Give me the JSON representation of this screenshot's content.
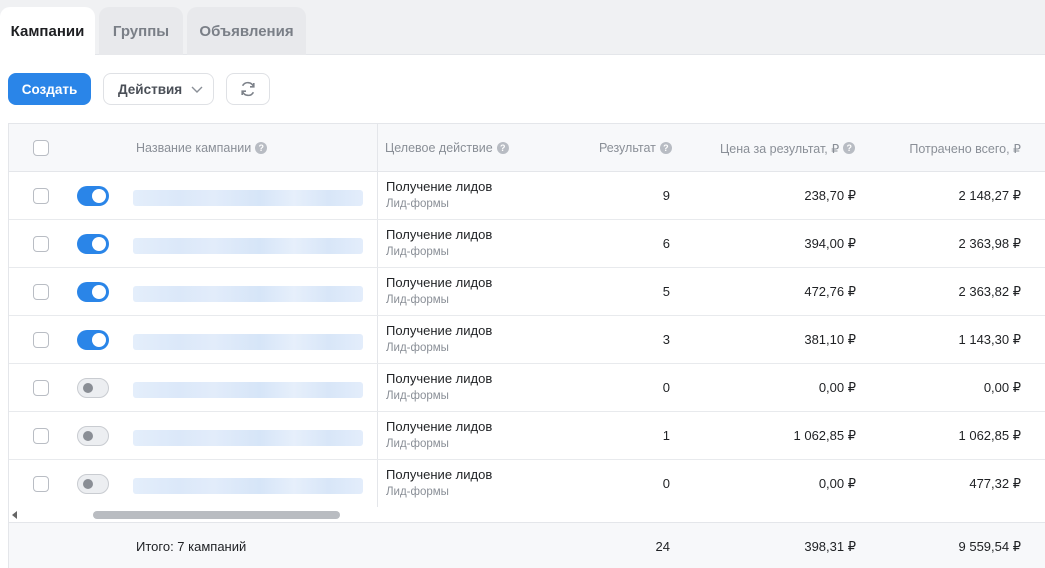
{
  "tabs": [
    {
      "label": "Кампании",
      "active": true
    },
    {
      "label": "Группы",
      "active": false
    },
    {
      "label": "Объявления",
      "active": false
    }
  ],
  "toolbar": {
    "create_label": "Создать",
    "actions_label": "Действия",
    "refresh_icon": "refresh-icon"
  },
  "colors": {
    "accent": "#2a85e8",
    "toggle_off": "#eceef1"
  },
  "table": {
    "headers": {
      "name": "Название кампании",
      "goal": "Целевое действие",
      "result": "Результат",
      "price": "Цена за результат, ₽",
      "spent": "Потрачено всего, ₽"
    },
    "rows": [
      {
        "enabled": true,
        "goal": "Получение лидов",
        "goal_sub": "Лид-формы",
        "result": "9",
        "price": "238,70 ₽",
        "spent": "2 148,27 ₽"
      },
      {
        "enabled": true,
        "goal": "Получение лидов",
        "goal_sub": "Лид-формы",
        "result": "6",
        "price": "394,00 ₽",
        "spent": "2 363,98 ₽"
      },
      {
        "enabled": true,
        "goal": "Получение лидов",
        "goal_sub": "Лид-формы",
        "result": "5",
        "price": "472,76 ₽",
        "spent": "2 363,82 ₽"
      },
      {
        "enabled": true,
        "goal": "Получение лидов",
        "goal_sub": "Лид-формы",
        "result": "3",
        "price": "381,10 ₽",
        "spent": "1 143,30 ₽"
      },
      {
        "enabled": false,
        "goal": "Получение лидов",
        "goal_sub": "Лид-формы",
        "result": "0",
        "price": "0,00 ₽",
        "spent": "0,00 ₽"
      },
      {
        "enabled": false,
        "goal": "Получение лидов",
        "goal_sub": "Лид-формы",
        "result": "1",
        "price": "1 062,85 ₽",
        "spent": "1 062,85 ₽"
      },
      {
        "enabled": false,
        "goal": "Получение лидов",
        "goal_sub": "Лид-формы",
        "result": "0",
        "price": "0,00 ₽",
        "spent": "477,32 ₽"
      }
    ],
    "footer": {
      "label": "Итого: 7 кампаний",
      "result": "24",
      "price": "398,31 ₽",
      "spent": "9 559,54 ₽"
    }
  }
}
